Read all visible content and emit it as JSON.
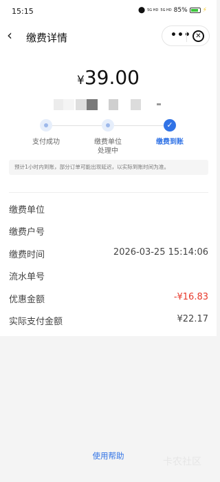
{
  "status_bar": {
    "time": "15:15",
    "network_1": "5G HD",
    "network_2": "5G HD",
    "battery": "85%",
    "battery_level": 0.85
  },
  "nav": {
    "back_icon": "‹",
    "title": "缴费详情",
    "more_icon": "•••",
    "close_icon": "✕"
  },
  "payment": {
    "currency_symbol": "¥",
    "amount": "39.00"
  },
  "steps": [
    {
      "label": "支付成功",
      "state": "done"
    },
    {
      "label": "缴费单位\n处理中",
      "state": "done"
    },
    {
      "label": "缴费到账",
      "state": "current",
      "icon": "✓"
    }
  ],
  "notice": "预计1小时内到账，部分订单可能出现延迟，以实际到账时间为准。",
  "details": [
    {
      "label": "缴费单位",
      "value": ""
    },
    {
      "label": "缴费户号",
      "value": ""
    },
    {
      "label": "缴费时间",
      "value": "2026-03-25 15:14:06"
    },
    {
      "label": "流水单号",
      "value": ""
    },
    {
      "label": "优惠金额",
      "value": "-¥16.83",
      "highlight": true
    },
    {
      "label": "实际支付金额",
      "value": "¥22.17"
    }
  ],
  "help_link": "使用帮助",
  "watermark": "卡农社区",
  "colors": {
    "accent": "#3173e6",
    "discount": "#e8392b",
    "step_pending": "#9db8ea"
  }
}
